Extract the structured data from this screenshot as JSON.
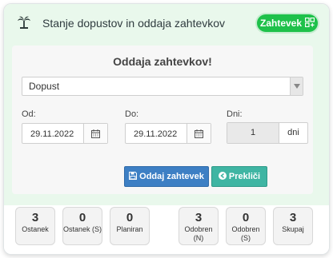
{
  "header": {
    "title": "Stanje dopustov in oddaja zahtevkov",
    "logo_icon": "palm-tree-icon",
    "request_pill": {
      "label": "Zahtevek",
      "icon": "grid-plus-icon"
    }
  },
  "form": {
    "title": "Oddaja zahtevkov!",
    "type_select": {
      "value": "Dopust"
    },
    "from": {
      "label": "Od:",
      "value": "29.11.2022"
    },
    "to": {
      "label": "Do:",
      "value": "29.11.2022"
    },
    "days": {
      "label": "Dni:",
      "value": "1",
      "unit": "dni"
    },
    "submit_label": "Oddaj zahtevek",
    "cancel_label": "Prekliči"
  },
  "stats": [
    {
      "value": "3",
      "label": "Ostanek"
    },
    {
      "value": "0",
      "label": "Ostanek (S)"
    },
    {
      "value": "0",
      "label": "Planiran"
    },
    {
      "value": "3",
      "label": "Odobren (N)"
    },
    {
      "value": "0",
      "label": "Odobren (S)"
    },
    {
      "value": "3",
      "label": "Skupaj"
    }
  ],
  "colors": {
    "accent_green": "#1ec14a",
    "primary_blue": "#3d7fc4",
    "teal": "#3fb5a3",
    "panel_bg": "#e9f8ec"
  }
}
